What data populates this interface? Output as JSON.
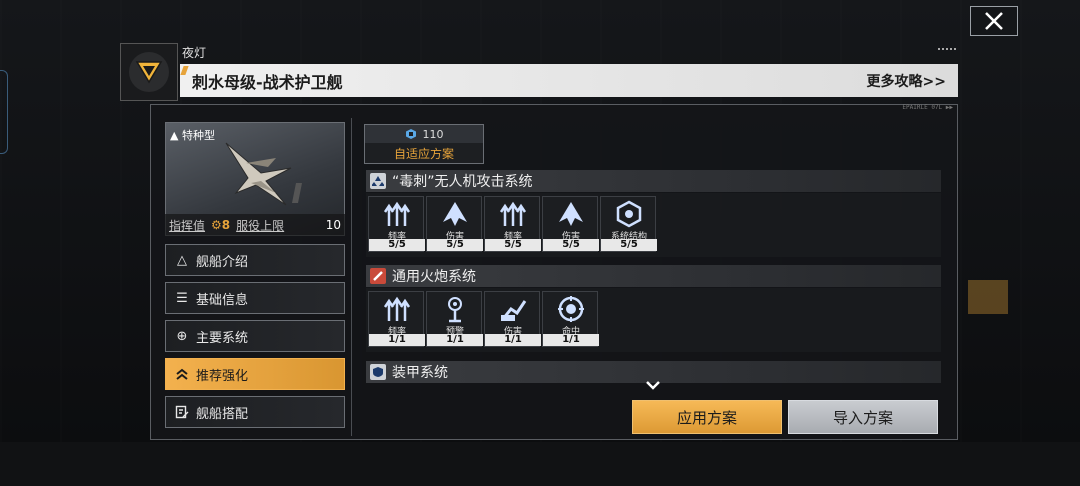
{
  "header": {
    "sub_label": "夜灯",
    "title": "刺水母级-战术护卫舰",
    "more_link": "更多攻略>>",
    "panel_tag": "EPAIRLE 07L ▶▶"
  },
  "ship": {
    "type_label": "特种型",
    "command_label": "指挥值",
    "command_value": "8",
    "service_label": "服役上限",
    "service_value": "10"
  },
  "menu": [
    {
      "label": "舰船介绍",
      "icon": "triangle-icon"
    },
    {
      "label": "基础信息",
      "icon": "list-icon"
    },
    {
      "label": "主要系统",
      "icon": "crosshair-icon"
    },
    {
      "label": "推荐强化",
      "icon": "double-chevron-up-icon",
      "active": true
    },
    {
      "label": "舰船搭配",
      "icon": "edit-doc-icon"
    }
  ],
  "scheme": {
    "cost": "110",
    "label": "自适应方案"
  },
  "sections": [
    {
      "title": "“毒刺”无人机攻击系统",
      "modules": [
        {
          "name": "频率",
          "level": "5/5",
          "icon": "frequency-icon"
        },
        {
          "name": "伤害",
          "level": "5/5",
          "icon": "damage-icon"
        },
        {
          "name": "频率",
          "level": "5/5",
          "icon": "frequency-icon"
        },
        {
          "name": "伤害",
          "level": "5/5",
          "icon": "damage-icon"
        },
        {
          "name": "系统结构",
          "level": "5/5",
          "icon": "structure-icon"
        }
      ]
    },
    {
      "title": "通用火炮系统",
      "modules": [
        {
          "name": "频率",
          "level": "1/1",
          "icon": "frequency-icon"
        },
        {
          "name": "预警",
          "level": "1/1",
          "icon": "warning-icon"
        },
        {
          "name": "伤害",
          "level": "1/1",
          "icon": "cannon-damage-icon"
        },
        {
          "name": "命中",
          "level": "1/1",
          "icon": "accuracy-icon"
        }
      ]
    },
    {
      "title": "装甲系统",
      "modules": []
    }
  ],
  "buttons": {
    "apply": "应用方案",
    "import": "导入方案"
  },
  "colors": {
    "accent": "#e6a33a",
    "panel": "#141518"
  }
}
